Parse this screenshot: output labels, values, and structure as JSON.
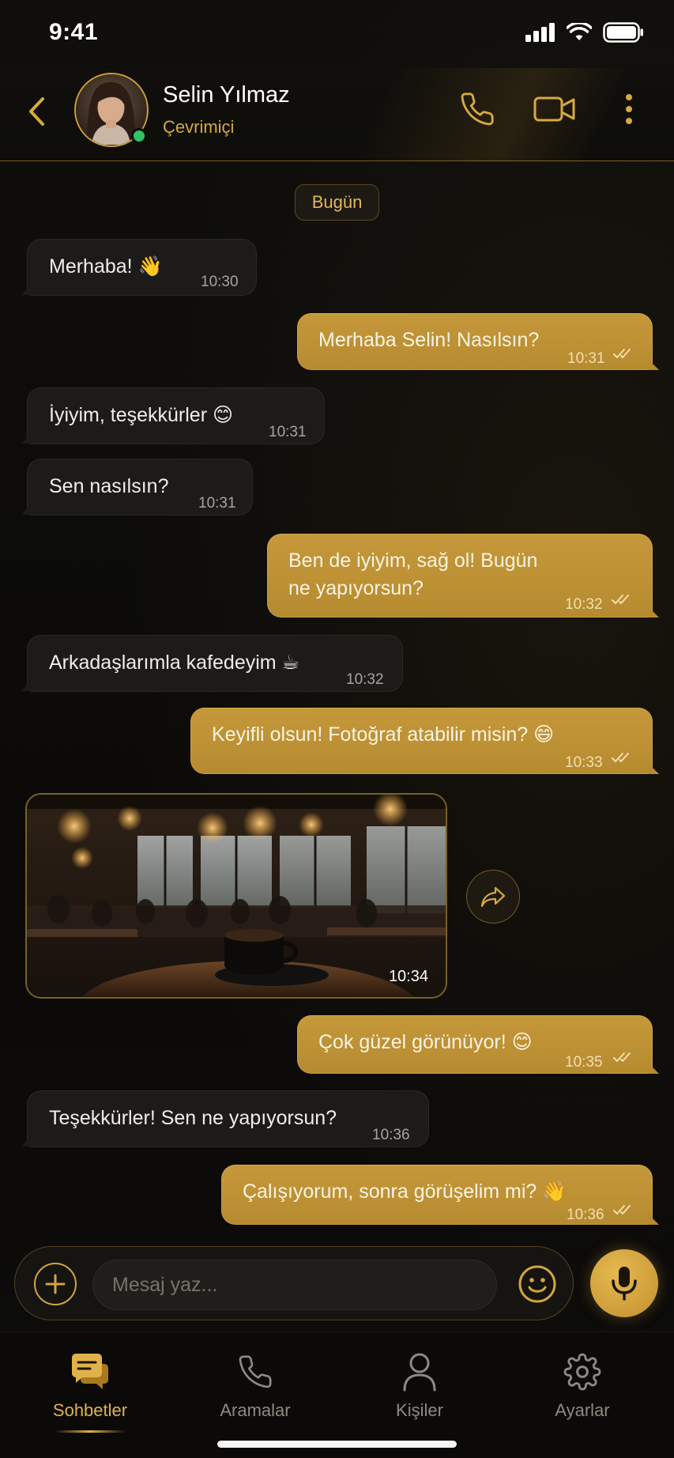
{
  "status_bar": {
    "time": "9:41"
  },
  "header": {
    "contact_name": "Selin Yılmaz",
    "contact_status": "Çevrimiçi",
    "online": true
  },
  "chat": {
    "date_label": "Bugün",
    "messages": [
      {
        "dir": "in",
        "text": "Merhaba! 👋",
        "time": "10:30"
      },
      {
        "dir": "out",
        "text": "Merhaba Selin! Nasılsın?",
        "time": "10:31",
        "read": true
      },
      {
        "dir": "in",
        "text": "İyiyim, teşekkürler 😊",
        "time": "10:31"
      },
      {
        "dir": "in",
        "text": "Sen nasılsın?",
        "time": "10:31"
      },
      {
        "dir": "out",
        "text": "Ben de iyiyim, sağ ol! Bugün",
        "text2": "ne yapıyorsun?",
        "time": "10:32",
        "read": true
      },
      {
        "dir": "in",
        "text": "Arkadaşlarımla kafedeyim ☕",
        "time": "10:32"
      },
      {
        "dir": "out",
        "text": "Keyifli olsun! Fotoğraf atabilir misin? 😄",
        "time": "10:33",
        "read": true
      },
      {
        "dir": "in",
        "type": "photo",
        "time": "10:34"
      },
      {
        "dir": "out",
        "text": "Çok güzel görünüyor! 😊",
        "time": "10:35",
        "read": true
      },
      {
        "dir": "in",
        "text": "Teşekkürler! Sen ne yapıyorsun?",
        "time": "10:36"
      },
      {
        "dir": "out",
        "text": "Çalışıyorum, sonra görüşelim mi? 👋",
        "time": "10:36",
        "read": true
      }
    ]
  },
  "composer": {
    "placeholder": "Mesaj yaz...",
    "value": ""
  },
  "tabs": [
    {
      "label": "Sohbetler",
      "icon": "chat-icon",
      "active": true
    },
    {
      "label": "Aramalar",
      "icon": "phone-icon",
      "active": false
    },
    {
      "label": "Kişiler",
      "icon": "person-icon",
      "active": false
    },
    {
      "label": "Ayarlar",
      "icon": "gear-icon",
      "active": false
    }
  ],
  "colors": {
    "accent": "#c99e3c",
    "outgoing_bubble": "#bf9236",
    "incoming_bubble": "#1c1b19",
    "online": "#2fc463",
    "background": "#0c0b09"
  }
}
